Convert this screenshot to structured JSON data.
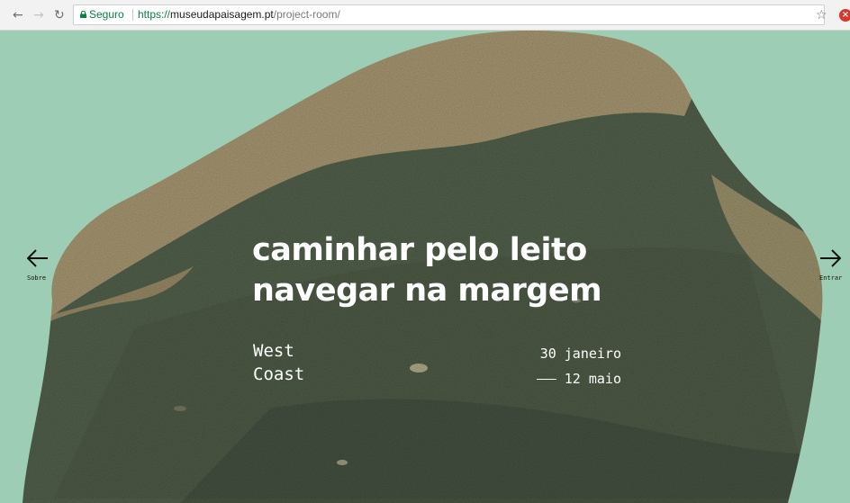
{
  "browser": {
    "back_icon": "back-arrow-icon",
    "forward_icon": "forward-arrow-icon",
    "reload_icon": "reload-icon",
    "secure_label": "Seguro",
    "url_scheme": "https://",
    "url_host": "museudapaisagem.pt",
    "url_path": "/project-room/",
    "bookmark_icon": "star-icon",
    "extension_icon": "extension-icon"
  },
  "exhibition": {
    "title_line1": "caminhar pelo leito",
    "title_line2": "navegar na margem",
    "venue_line1": "West",
    "venue_line2": "Coast",
    "date_start": "30 janeiro",
    "date_end": "12 maio"
  },
  "navigation": {
    "prev_label": "Sobre",
    "next_label": "Entrar"
  },
  "colors": {
    "page_background": "#9ecdb5",
    "text": "#ffffff",
    "arrows": "#111111",
    "secure": "#0b8043"
  }
}
